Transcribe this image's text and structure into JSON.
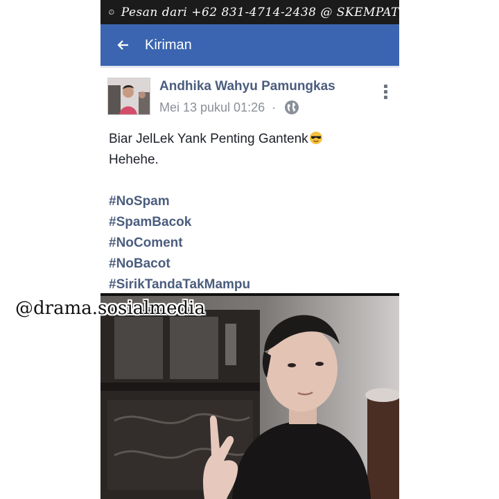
{
  "status_bar": {
    "text": "Pesan dari +62 831-4714-2438 @ SKEMPAT",
    "icon": "whatsapp-icon"
  },
  "app_bar": {
    "title": "Kiriman",
    "back_icon": "arrow-left-icon"
  },
  "post": {
    "author": "Andhika Wahyu Pamungkas",
    "timestamp": "Mei 13 pukul 01:26",
    "separator": "·",
    "privacy_icon": "globe-icon",
    "menu_icon": "more-vertical-icon",
    "text_line1": "Biar JelLek Yank Penting Gantenk",
    "text_line1_emoji": "sunglasses-emoji",
    "text_line2": "Hehehe.",
    "hashtags": [
      "#NoSpam",
      "#SpamBacok",
      "#NoComent",
      "#NoBacot",
      "#SirikTandaTakMampu"
    ]
  },
  "watermark": "@drama.sosialmedia",
  "colors": {
    "app_bar": "#3b65b0",
    "status_bar": "#1b1b1b",
    "author": "#4b5d7e",
    "meta": "#8a8f98"
  }
}
